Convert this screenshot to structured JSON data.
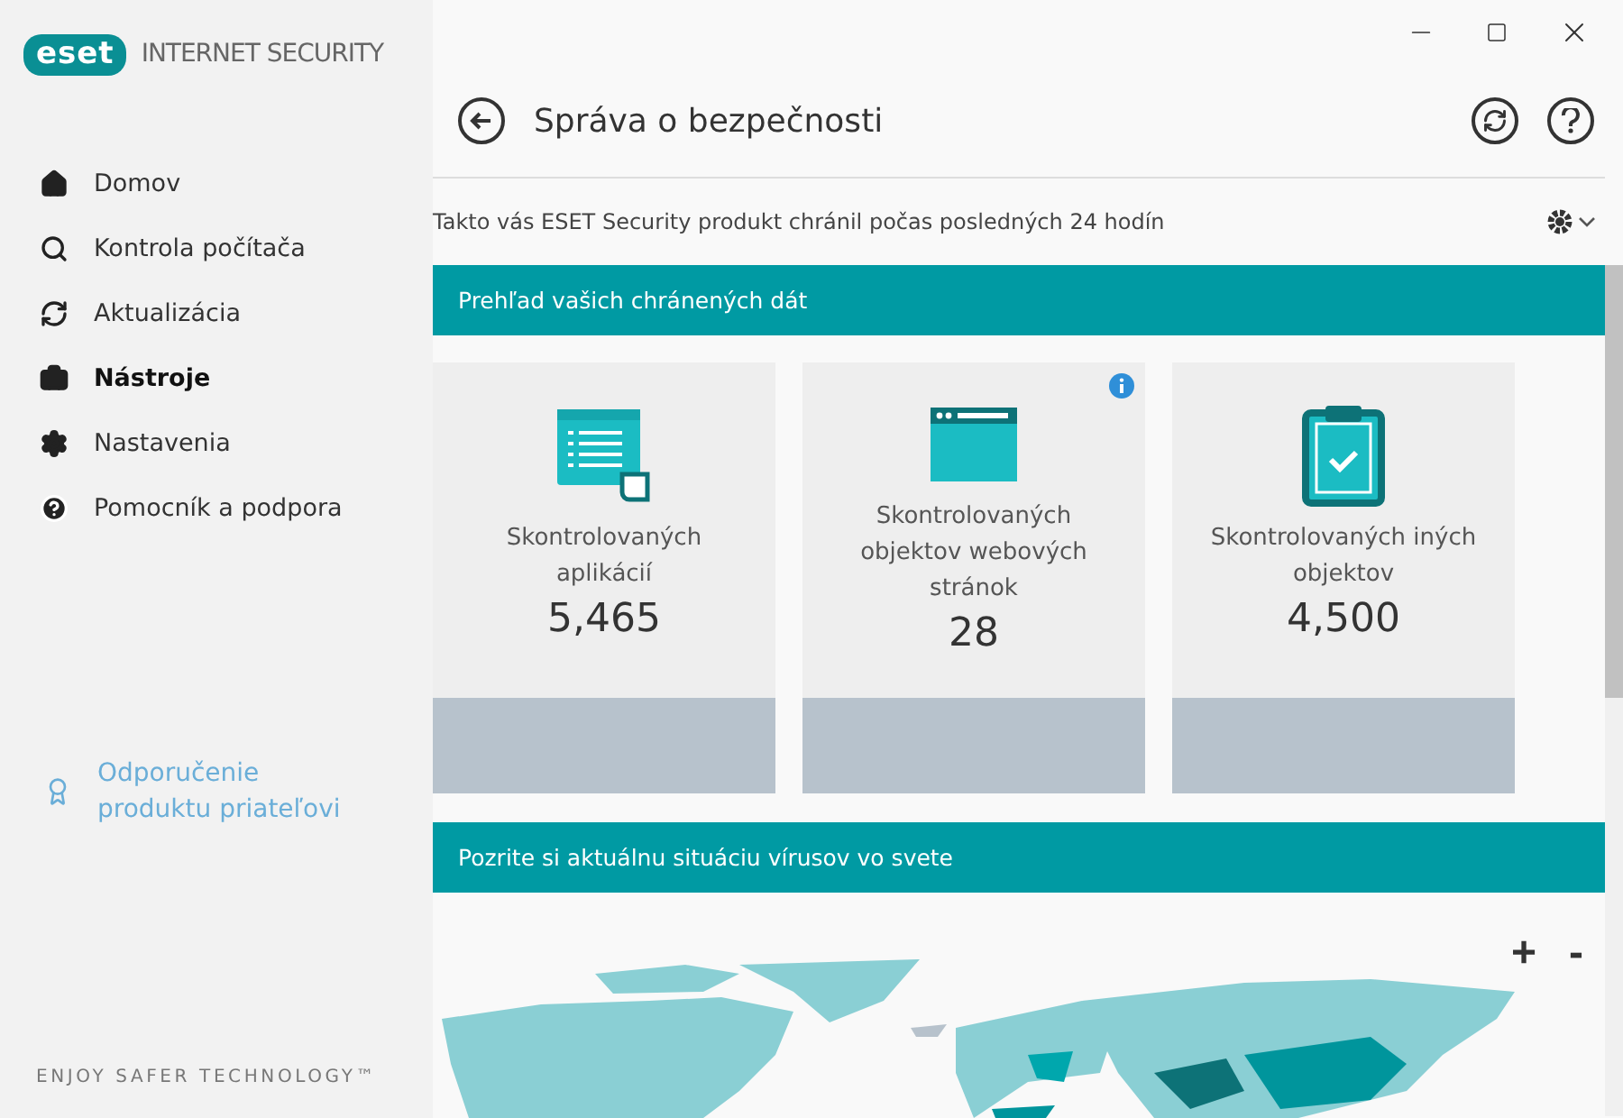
{
  "header": {
    "logo": "eset",
    "product": "INTERNET SECURITY"
  },
  "sidebar": {
    "items": [
      {
        "label": "Domov",
        "selected": false
      },
      {
        "label": "Kontrola počítača",
        "selected": false
      },
      {
        "label": "Aktualizácia",
        "selected": false
      },
      {
        "label": "Nástroje",
        "selected": true
      },
      {
        "label": "Nastavenia",
        "selected": false
      },
      {
        "label": "Pomocník a podpora",
        "selected": false
      }
    ],
    "referral": "Odporučenie produktu priateľovi",
    "tagline": "ENJOY SAFER TECHNOLOGY™"
  },
  "page": {
    "title": "Správa o bezpečnosti",
    "subtitle": "Takto vás ESET Security produkt chránil počas posledných 24 hodín"
  },
  "sections": [
    {
      "title": "Prehľad vašich chránených dát"
    },
    {
      "title": "Pozrite si aktuálnu situáciu vírusov vo svete"
    }
  ],
  "cards": [
    {
      "kind": "apps",
      "label": "Skontrolovaných aplikácií",
      "value": "5,465",
      "info": false
    },
    {
      "kind": "web",
      "label": "Skontrolovaných objektov webových stránok",
      "value": "28",
      "info": true
    },
    {
      "kind": "other",
      "label": "Skontrolovaných iných objektov",
      "value": "4,500",
      "info": false
    }
  ],
  "map": {
    "zoom_in": "+",
    "zoom_out": "-"
  }
}
